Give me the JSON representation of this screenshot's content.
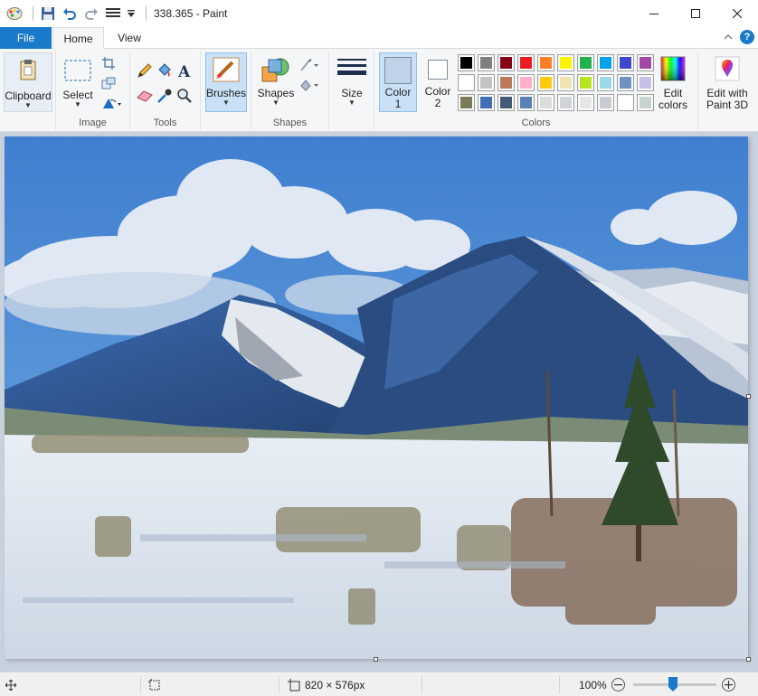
{
  "window": {
    "title": "338.365 - Paint"
  },
  "tabs": {
    "file": "File",
    "home": "Home",
    "view": "View"
  },
  "ribbon": {
    "clipboard": {
      "label": "Clipboard"
    },
    "image": {
      "select_label": "Select",
      "group_label": "Image"
    },
    "tools": {
      "group_label": "Tools"
    },
    "brushes": {
      "label": "Brushes"
    },
    "shapes": {
      "label": "Shapes",
      "group_label": "Shapes"
    },
    "size": {
      "label": "Size"
    },
    "colors": {
      "color1_label": "Color",
      "color1_num": "1",
      "color2_label": "Color",
      "color2_num": "2",
      "color1_value": "#c0d2e8",
      "color2_value": "#ffffff",
      "edit_colors_line1": "Edit",
      "edit_colors_line2": "colors",
      "group_label": "Colors",
      "palette_row1": [
        "#000000",
        "#7f7f7f",
        "#880015",
        "#ed1c24",
        "#ff7f27",
        "#fff200",
        "#22b14c",
        "#00a2e8",
        "#3f48cc",
        "#a349a4"
      ],
      "palette_row2": [
        "#ffffff",
        "#c3c3c3",
        "#b97a57",
        "#ffaec9",
        "#ffc90e",
        "#efe4b0",
        "#b5e61d",
        "#99d9ea",
        "#7092be",
        "#c8bfe7"
      ],
      "palette_row3": [
        "#7b7b57",
        "#3f6fb0",
        "#465a78",
        "#5a80b4",
        "#dcdcdc",
        "#d0d3d8",
        "#e6e6e6",
        "#c8ccd2",
        "#ffffff",
        "#c8d4d0"
      ]
    },
    "paint3d": {
      "line1": "Edit with",
      "line2": "Paint 3D"
    }
  },
  "status": {
    "dimensions": "820 × 576px",
    "zoom": "100%"
  }
}
